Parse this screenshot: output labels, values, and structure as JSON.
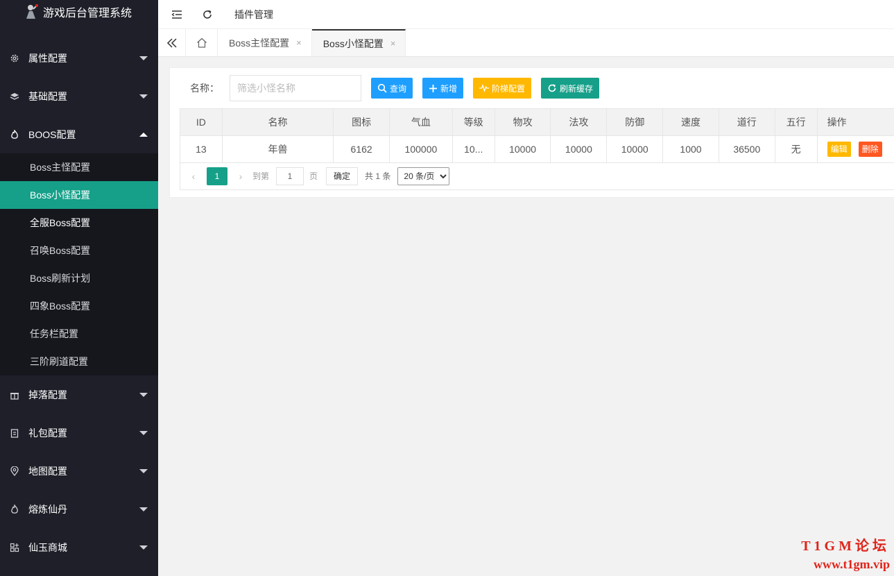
{
  "app": {
    "title": "游戏后台管理系统"
  },
  "sidebar": {
    "groups_top": [
      {
        "label": "属性配置",
        "icon": "gear-icon"
      },
      {
        "label": "基础配置",
        "icon": "layers-icon"
      },
      {
        "label": "BOOS配置",
        "icon": "fire-icon",
        "expanded": true
      }
    ],
    "sub_items": [
      {
        "label": "Boss主怪配置"
      },
      {
        "label": "Boss小怪配置",
        "active": true
      },
      {
        "label": "全服Boss配置"
      },
      {
        "label": "召唤Boss配置"
      },
      {
        "label": "Boss刷新计划"
      },
      {
        "label": "四象Boss配置"
      },
      {
        "label": "任务栏配置"
      },
      {
        "label": "三阶刷道配置"
      }
    ],
    "groups_bottom": [
      {
        "label": "掉落配置",
        "icon": "gift-icon"
      },
      {
        "label": "礼包配置",
        "icon": "clipboard-icon"
      },
      {
        "label": "地图配置",
        "icon": "location-icon"
      },
      {
        "label": "熔炼仙丹",
        "icon": "fire-icon"
      },
      {
        "label": "仙玉商城",
        "icon": "apps-icon"
      }
    ]
  },
  "header": {
    "plugin_label": "插件管理"
  },
  "tabs": [
    {
      "label": "Boss主怪配置",
      "close": "×"
    },
    {
      "label": "Boss小怪配置",
      "close": "×",
      "active": true
    }
  ],
  "search": {
    "label": "名称：",
    "placeholder": "筛选小怪名称",
    "buttons": {
      "query": "查询",
      "add": "新增",
      "stage": "阶梯配置",
      "refresh": "刷新缓存"
    }
  },
  "table": {
    "columns": [
      "ID",
      "名称",
      "图标",
      "气血",
      "等级",
      "物攻",
      "法攻",
      "防御",
      "速度",
      "道行",
      "五行",
      "操作"
    ],
    "rows": [
      {
        "id": "13",
        "name": "年兽",
        "icon": "6162",
        "hp": "100000",
        "level": "10...",
        "patk": "10000",
        "matk": "10000",
        "def": "10000",
        "speed": "1000",
        "dao": "36500",
        "element": "无",
        "edit": "编辑",
        "delete": "删除"
      }
    ]
  },
  "pager": {
    "prev": "‹",
    "page": "1",
    "next": "›",
    "goto": "到第",
    "goto_value": "1",
    "page_unit": "页",
    "confirm": "确定",
    "total": "共 1 条",
    "page_size": "20 条/页"
  },
  "watermark": {
    "line1": "T1GM论坛",
    "line2": "www.t1gm.vip"
  },
  "colors": {
    "sidebar_bg": "#1e1f29",
    "active": "#16a089",
    "blue": "#1e9fff",
    "orange": "#ffb800",
    "danger": "#ff5722"
  }
}
